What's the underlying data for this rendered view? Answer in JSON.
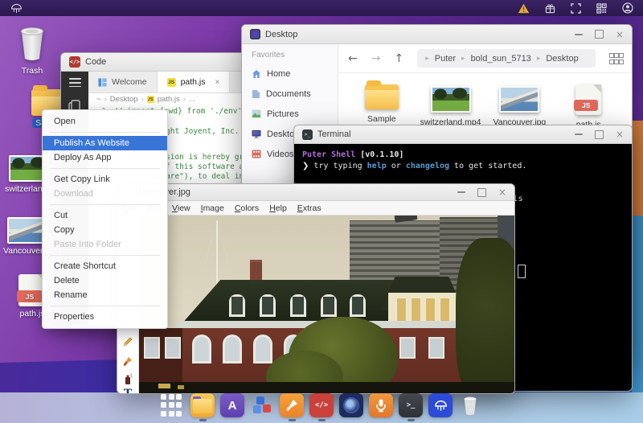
{
  "topbar": {
    "icon_names": [
      "puter-logo",
      "warning",
      "gift",
      "fullscreen",
      "qr-code",
      "account"
    ]
  },
  "desktop_icons": [
    {
      "label": "Trash",
      "type": "trash"
    },
    {
      "label": "Sample",
      "type": "folder",
      "selected": true
    },
    {
      "label": "switzerland.mp4",
      "type": "video"
    },
    {
      "label": "Vancouver.jpg",
      "type": "image"
    },
    {
      "label": "path.js",
      "type": "js"
    }
  ],
  "context_menu": {
    "items": [
      {
        "label": "Open"
      },
      {
        "label": "Publish As Website",
        "highlighted": true
      },
      {
        "label": "Deploy As App"
      },
      {
        "label": "Get Copy Link"
      },
      {
        "label": "Download",
        "disabled": true
      },
      {
        "label": "Cut"
      },
      {
        "label": "Copy"
      },
      {
        "label": "Paste Into Folder",
        "disabled": true
      },
      {
        "label": "Create Shortcut"
      },
      {
        "label": "Delete"
      },
      {
        "label": "Rename"
      },
      {
        "label": "Properties"
      }
    ],
    "highlight_color": "#3875d7"
  },
  "code_window": {
    "title": "Code",
    "tab_welcome": "Welcome",
    "tab_active": "path.js",
    "tab_close": "×",
    "breadcrumb": {
      "root": "~",
      "p1": "Desktop",
      "p2": "path.js",
      "p3": "..."
    },
    "js_badge": "JS",
    "line_number": "1",
    "line1": "// import {cwd} from './env'",
    "frag1": "ght Joyent, Inc. a",
    "frag2": "sion is hereby gra",
    "frag3": "f this software an",
    "frag4": "are\"), to deal in",
    "comment_color": "#3e8a3e"
  },
  "file_manager": {
    "title": "Desktop",
    "favorites_header": "Favorites",
    "sidebar": [
      {
        "label": "Home"
      },
      {
        "label": "Documents"
      },
      {
        "label": "Pictures"
      },
      {
        "label": "Desktop"
      },
      {
        "label": "Videos"
      }
    ],
    "nav": {
      "back": "←",
      "forward": "→",
      "up": "↑"
    },
    "breadcrumb": {
      "b0": "Puter",
      "b1": "bold_sun_5713",
      "b2": "Desktop"
    },
    "files": [
      {
        "label": "Sample",
        "type": "folder"
      },
      {
        "label": "switzerland.mp4",
        "type": "video"
      },
      {
        "label": "Vancouver.jpg",
        "type": "image"
      },
      {
        "label": "path.js",
        "type": "js"
      }
    ]
  },
  "terminal": {
    "title": "Terminal",
    "icon_glyph": ">_",
    "brand": "Puter Shell",
    "version": "[v0.1.10]",
    "prompt": "❯",
    "hint_pre": "try typing ",
    "hint_link1": "help",
    "hint_mid": " or ",
    "hint_link2": "changelog",
    "hint_post": " to get started.",
    "command": "ls",
    "brand_color": "#b16cd6",
    "link_color": "#5a9fd4"
  },
  "viewer": {
    "title": "Vancouver.jpg",
    "menus": [
      "File",
      "Edit",
      "View",
      "Image",
      "Colors",
      "Help",
      "Extras"
    ],
    "tools": [
      "pencil",
      "brush",
      "spray-can",
      "text"
    ],
    "text_tool_glyph": "T"
  },
  "dock": {
    "items": [
      {
        "name": "launcher"
      },
      {
        "name": "files",
        "active": true
      },
      {
        "name": "editor",
        "glyph": "A"
      },
      {
        "name": "blocks"
      },
      {
        "name": "paint",
        "active": true
      },
      {
        "name": "code",
        "glyph": "</>",
        "active": true
      },
      {
        "name": "camera"
      },
      {
        "name": "recorder"
      },
      {
        "name": "terminal",
        "glyph": ">_",
        "active": true
      },
      {
        "name": "puter"
      },
      {
        "name": "trash"
      }
    ]
  }
}
